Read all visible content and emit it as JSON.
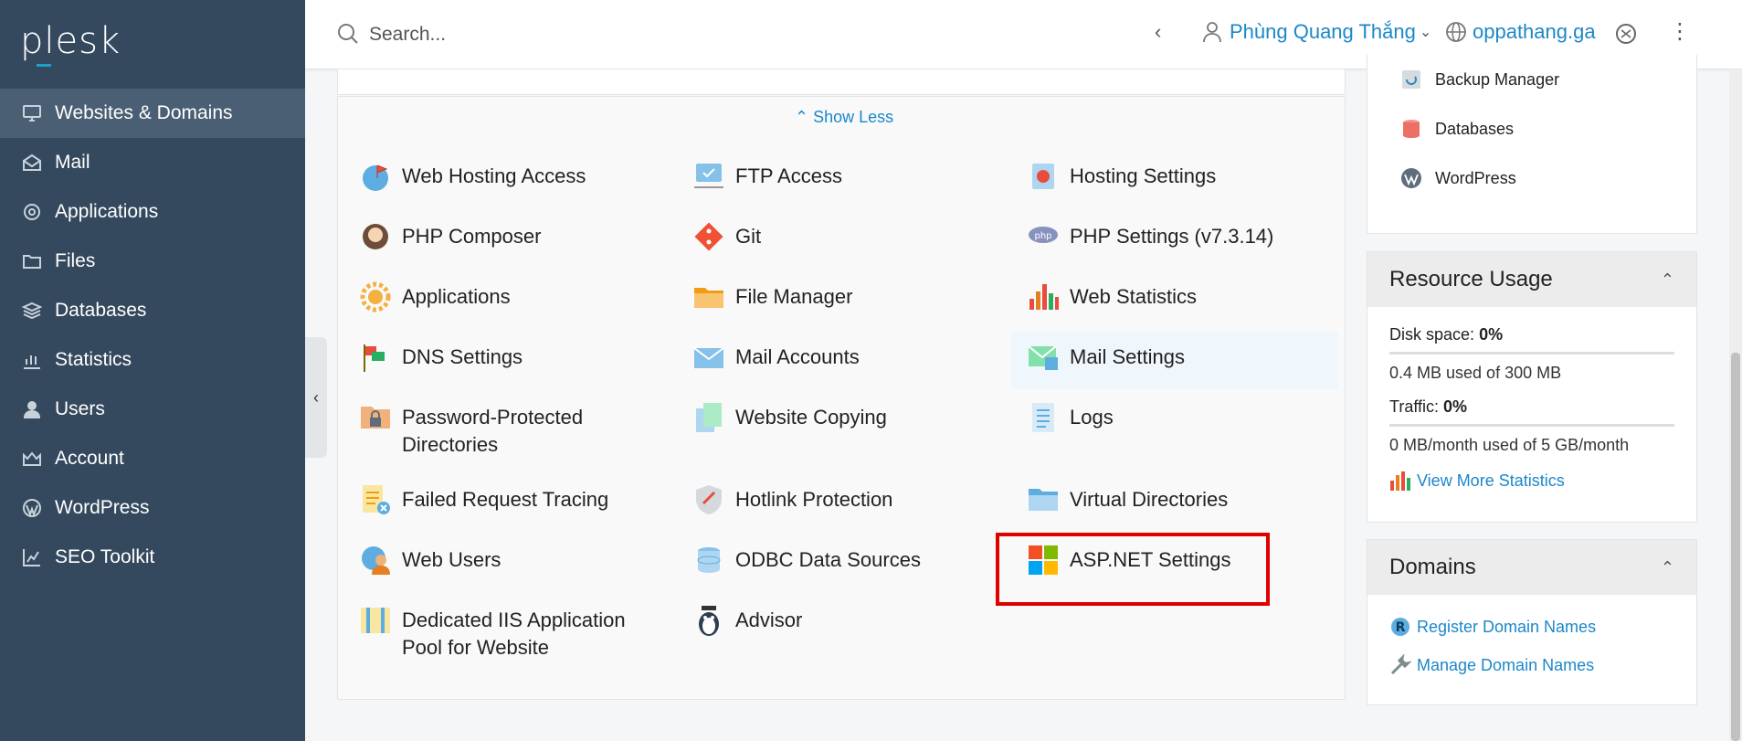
{
  "sidebar": {
    "logo": "plesk",
    "items": [
      {
        "label": "Websites & Domains",
        "icon": "monitor-icon",
        "active": true
      },
      {
        "label": "Mail",
        "icon": "mail-icon"
      },
      {
        "label": "Applications",
        "icon": "gear-icon"
      },
      {
        "label": "Files",
        "icon": "folder-icon"
      },
      {
        "label": "Databases",
        "icon": "database-icon"
      },
      {
        "label": "Statistics",
        "icon": "bar-chart-icon"
      },
      {
        "label": "Users",
        "icon": "user-icon"
      },
      {
        "label": "Account",
        "icon": "crown-icon"
      },
      {
        "label": "WordPress",
        "icon": "wordpress-icon"
      },
      {
        "label": "SEO Toolkit",
        "icon": "seo-chart-icon"
      }
    ]
  },
  "header": {
    "search_placeholder": "Search...",
    "user_name": "Phùng Quang Thắng",
    "domain": "oppathang.ga"
  },
  "tools": {
    "show_less": "Show Less",
    "items": [
      {
        "label": "Web Hosting Access",
        "icon": "globe-flag-icon"
      },
      {
        "label": "FTP Access",
        "icon": "ftp-monitor-icon"
      },
      {
        "label": "Hosting Settings",
        "icon": "hosting-settings-icon"
      },
      {
        "label": "PHP Composer",
        "icon": "composer-icon"
      },
      {
        "label": "Git",
        "icon": "git-icon"
      },
      {
        "label": "PHP Settings (v7.3.14)",
        "icon": "php-icon"
      },
      {
        "label": "Applications",
        "icon": "applications-gear-icon"
      },
      {
        "label": "File Manager",
        "icon": "file-manager-folder-icon"
      },
      {
        "label": "Web Statistics",
        "icon": "web-statistics-icon"
      },
      {
        "label": "DNS Settings",
        "icon": "dns-flags-icon"
      },
      {
        "label": "Mail Accounts",
        "icon": "envelope-icon"
      },
      {
        "label": "Mail Settings",
        "icon": "mail-settings-icon"
      },
      {
        "label": "Password-Protected",
        "label2": "Directories",
        "icon": "locked-folder-icon"
      },
      {
        "label": "Website Copying",
        "icon": "copy-pages-icon"
      },
      {
        "label": "Logs",
        "icon": "log-file-icon"
      },
      {
        "label": "Failed Request Tracing",
        "icon": "failed-request-icon"
      },
      {
        "label": "Hotlink Protection",
        "icon": "shield-link-icon"
      },
      {
        "label": "Virtual Directories",
        "icon": "virtual-folder-icon"
      },
      {
        "label": "Web Users",
        "icon": "web-users-icon"
      },
      {
        "label": "ODBC Data Sources",
        "icon": "odbc-database-icon"
      },
      {
        "label": "ASP.NET Settings",
        "icon": "windows-logo-icon"
      },
      {
        "label": "Dedicated IIS Application",
        "label2": "Pool for Website",
        "icon": "iis-pool-icon"
      },
      {
        "label": "Advisor",
        "icon": "penguin-advisor-icon"
      }
    ]
  },
  "right": {
    "links": [
      {
        "label": "Backup Manager",
        "icon": "backup-icon"
      },
      {
        "label": "Databases",
        "icon": "database-red-icon"
      },
      {
        "label": "WordPress",
        "icon": "wordpress-logo-icon"
      }
    ],
    "resource": {
      "title": "Resource Usage",
      "disk_label": "Disk space:",
      "disk_value": "0%",
      "disk_sub": "0.4 MB used of 300 MB",
      "traffic_label": "Traffic:",
      "traffic_value": "0%",
      "traffic_sub": "0 MB/month used of 5 GB/month",
      "more_stats": "View More Statistics"
    },
    "domains": {
      "title": "Domains",
      "register": "Register Domain Names",
      "manage": "Manage Domain Names"
    }
  },
  "colors": {
    "sidebar_bg": "#34495e",
    "link_blue": "#1c87c9",
    "highlight_red": "#e00000"
  }
}
